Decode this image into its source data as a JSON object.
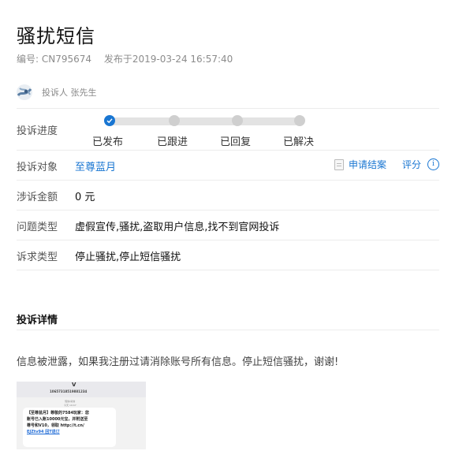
{
  "title": "骚扰短信",
  "meta": {
    "serial": "编号: CN795674",
    "published": "发布于2019-03-24 16:57:40"
  },
  "complainant": {
    "label": "投诉人 张先生"
  },
  "progress": {
    "label": "投诉进度",
    "current_step": 1,
    "total_steps": 4,
    "steps": [
      "已发布",
      "已跟进",
      "已回复",
      "已解决"
    ]
  },
  "target": {
    "label": "投诉对象",
    "value": "至尊蓝月",
    "apply_close": "申请结案",
    "rate": "评分",
    "info_glyph": "i"
  },
  "amount": {
    "label": "涉诉金额",
    "value": "0 元"
  },
  "issue_type": {
    "label": "问题类型",
    "value": "虚假宣传,骚扰,盗取用户信息,找不到官网投诉"
  },
  "demand_type": {
    "label": "诉求类型",
    "value": "停止骚扰,停止短信骚扰"
  },
  "details": {
    "heading": "投诉详情",
    "text": "信息被泄露，如果我注册过请消除账号所有信息。停止短信骚扰，谢谢!"
  },
  "thumbnail": {
    "avatar_glyph": "V",
    "phone": "10657318519881234",
    "mid_line1": "短信/彩信",
    "mid_line2": "今天 19:47",
    "sms_lines": [
      "【至尊蓝月】尊敬的7584玩家：您",
      "账号已入账10000元宝，并附送至",
      "尊号和V10，领取 http://t.cn/",
      "EJZtv94 回T退订"
    ]
  },
  "colors": {
    "accent": "#1976d2",
    "divider": "#ececec",
    "muted": "#8c8c8c"
  }
}
